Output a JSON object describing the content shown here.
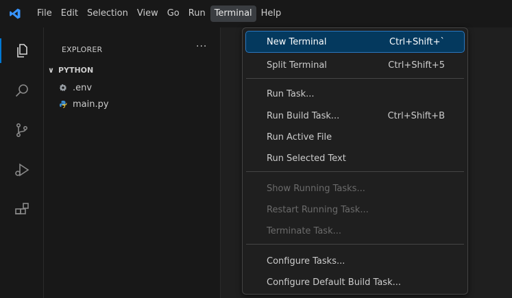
{
  "menubar": {
    "logo_icon": "vscode-logo-icon",
    "items": [
      "File",
      "Edit",
      "Selection",
      "View",
      "Go",
      "Run",
      "Terminal",
      "Help"
    ],
    "active": "Terminal"
  },
  "activitybar": {
    "icons": [
      "explorer-icon",
      "search-icon",
      "source-control-icon",
      "run-debug-icon",
      "extensions-icon"
    ],
    "accent": "#0078d4"
  },
  "sidebar": {
    "header": "EXPLORER",
    "more": "···",
    "folder_chevron": "∨",
    "folder": "PYTHON",
    "files": [
      {
        "name": ".env",
        "icon": "gear-icon"
      },
      {
        "name": "main.py",
        "icon": "python-icon"
      }
    ]
  },
  "terminal_menu": {
    "items": {
      "new_terminal": {
        "label": "New Terminal",
        "shortcut": "Ctrl+Shift+`"
      },
      "split_terminal": {
        "label": "Split Terminal",
        "shortcut": "Ctrl+Shift+5"
      },
      "run_task": {
        "label": "Run Task..."
      },
      "run_build_task": {
        "label": "Run Build Task...",
        "shortcut": "Ctrl+Shift+B"
      },
      "run_active_file": {
        "label": "Run Active File"
      },
      "run_selected_text": {
        "label": "Run Selected Text"
      },
      "show_running_tasks": {
        "label": "Show Running Tasks..."
      },
      "restart_running_task": {
        "label": "Restart Running Task..."
      },
      "terminate_task": {
        "label": "Terminate Task..."
      },
      "configure_tasks": {
        "label": "Configure Tasks..."
      },
      "configure_default_build_task": {
        "label": "Configure Default Build Task..."
      }
    },
    "highlight_color": "#04395e"
  }
}
